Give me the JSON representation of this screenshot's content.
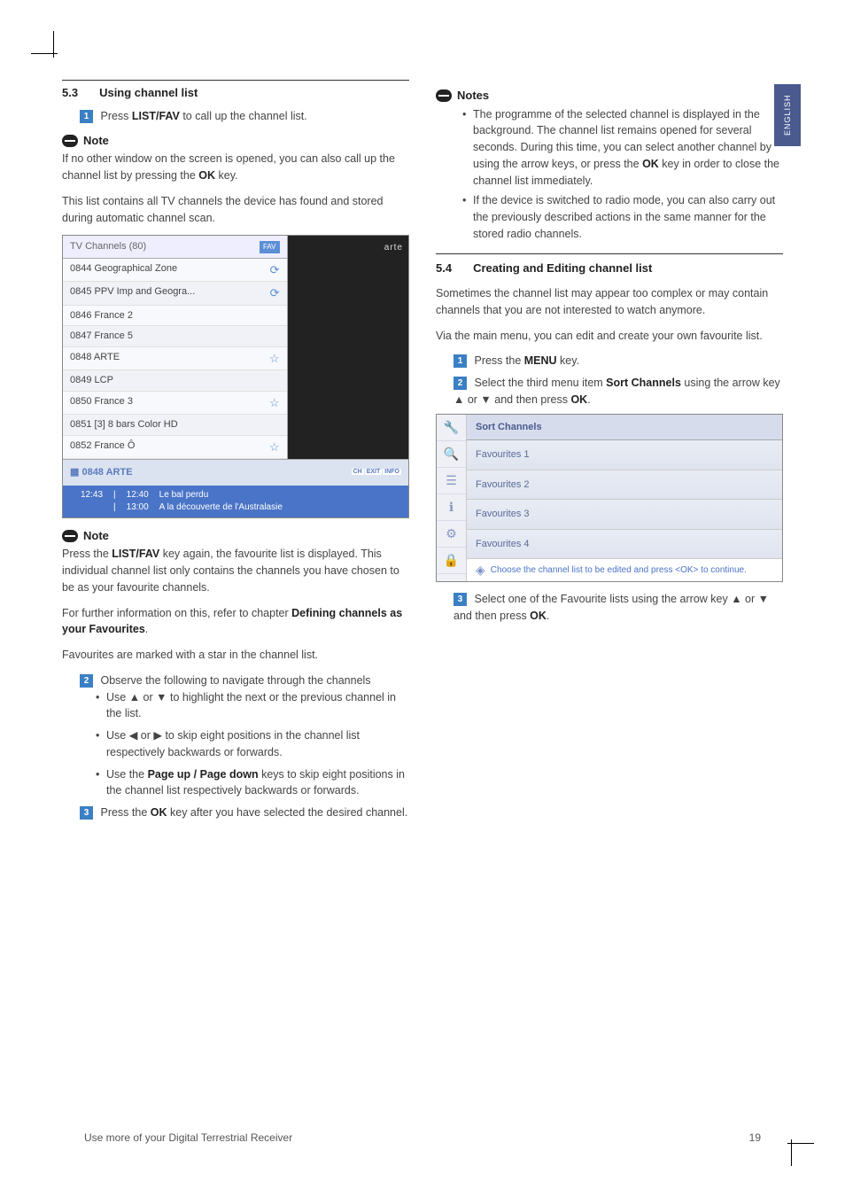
{
  "sideTab": "ENGLISH",
  "left": {
    "sec_num": "5.3",
    "sec_title": "Using channel list",
    "step1": "Press ",
    "step1_key": "LIST/FAV",
    "step1_after": " to call up the channel list.",
    "note_label": "Note",
    "note1": "If no other window on the screen is opened, you can also call up the channel list by pressing the ",
    "note1_key": "OK",
    "note1_after": " key.",
    "para2": "This list contains all TV channels the device has found and stored during automatic channel scan.",
    "screenshot1": {
      "header": "TV Channels (80)",
      "fav": "FAV",
      "rows": [
        {
          "num": "0844",
          "name": "Geographical Zone",
          "icon": "⟳"
        },
        {
          "num": "0845",
          "name": "PPV Imp and Geogra...",
          "icon": "⟳"
        },
        {
          "num": "0846",
          "name": "France 2",
          "icon": ""
        },
        {
          "num": "0847",
          "name": "France 5",
          "icon": ""
        },
        {
          "num": "0848",
          "name": "ARTE",
          "icon": "☆"
        },
        {
          "num": "0849",
          "name": "LCP",
          "icon": ""
        },
        {
          "num": "0850",
          "name": "France 3",
          "icon": "☆"
        },
        {
          "num": "0851",
          "name": "[3] 8 bars Color HD",
          "icon": ""
        },
        {
          "num": "0852",
          "name": "France Ô",
          "icon": "☆"
        }
      ],
      "preview_label": "arte",
      "bottom_num": "0848",
      "bottom_name": "ARTE",
      "bottom_badges": [
        "CH",
        "EXIT",
        "INFO"
      ],
      "footer_time": "12:43",
      "footer_line1a": "12:40",
      "footer_line1b": "Le bal perdu",
      "footer_line2a": "13:00",
      "footer_line2b": "A la découverte de l'Australasie"
    },
    "note2_label": "Note",
    "note2_a": "Press the ",
    "note2_key": "LIST/FAV",
    "note2_b": " key again, the favourite list is displayed. This individual channel list only contains the channels you have chosen to be as your favourite channels.",
    "note2_c": "For further information on this, refer to chapter ",
    "note2_link": "Defining channels as your Favourites",
    "note2_d": "Favourites are marked with a star in the channel list.",
    "step2_intro": "Observe the following to navigate through the channels",
    "step2_b1": "Use ▲ or ▼ to highlight the next or the previous channel in the list.",
    "step2_b2": "Use ◀ or ▶ to skip eight positions in the channel list respectively backwards or forwards.",
    "step2_b3a": "Use the ",
    "step2_b3_key": "Page up / Page down",
    "step2_b3b": " keys to skip eight positions in the channel list respectively backwards or forwards.",
    "step3a": "Press the ",
    "step3_key": "OK",
    "step3b": " key after you have selected the desired channel."
  },
  "right": {
    "notes_label": "Notes",
    "nb1a": "The programme of the selected channel is displayed in the background. The channel list remains opened for several seconds. During this time, you can select another channel by using the arrow keys, or press the ",
    "nb1_key": "OK",
    "nb1b": " key in order to close the channel list immediately.",
    "nb2": "If the device is switched to radio mode, you can also carry out the previously described actions in the same manner for the stored radio channels.",
    "sec_num": "5.4",
    "sec_title": "Creating and Editing channel list",
    "para1": "Sometimes the channel list may appear too complex or may contain channels that you are not interested to watch anymore.",
    "para2": "Via the main menu, you can edit and create your own favourite list.",
    "step1a": "Press the ",
    "step1_key": "MENU",
    "step1b": " key.",
    "step2a": "Select the third menu item ",
    "step2_key": "Sort Channels",
    "step2b": " using the arrow key ▲ or ▼ and then press ",
    "step2_key2": "OK",
    "step2c": ".",
    "screenshot2": {
      "title": "Sort Channels",
      "items": [
        "Favourites 1",
        "Favourites 2",
        "Favourites 3",
        "Favourites 4"
      ],
      "footer": "Choose the channel list to be edited and press <OK> to continue."
    },
    "step3a": "Select one of the Favourite lists using the arrow key ▲ or ▼ and then press ",
    "step3_key": "OK",
    "step3b": "."
  },
  "footer_left": "Use more of your Digital Terrestrial Receiver",
  "footer_right": "19"
}
